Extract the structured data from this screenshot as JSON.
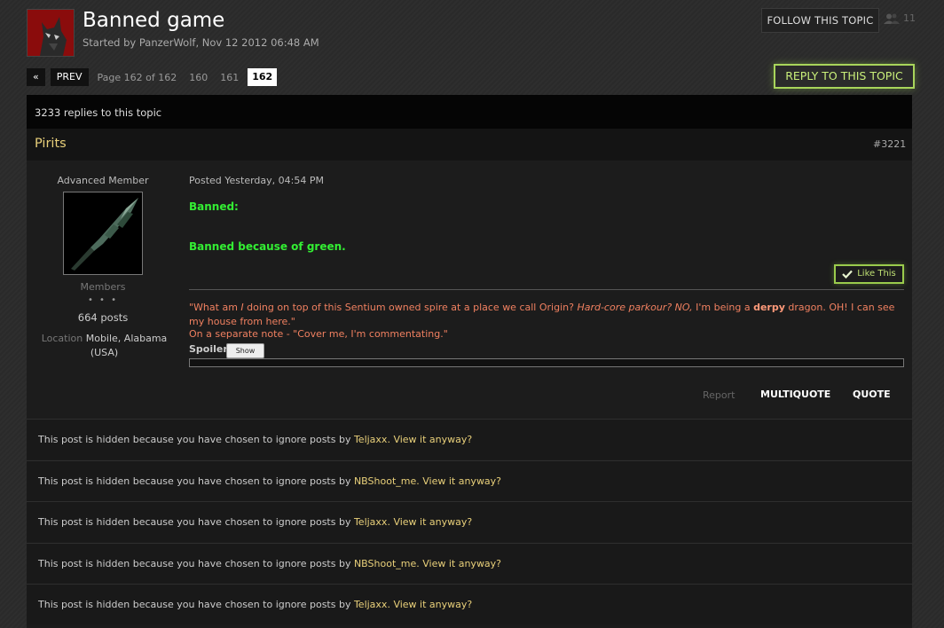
{
  "topic": {
    "title": "Banned game",
    "started": "Started by PanzerWolf, Nov 12 2012 06:48 AM",
    "follow_label": "FOLLOW THIS TOPIC",
    "followers": "11"
  },
  "pagination": {
    "first": "«",
    "prev": "PREV",
    "info": "Page 162 of 162",
    "pages": [
      "160",
      "161"
    ],
    "current": "162"
  },
  "reply_label": "REPLY TO THIS TOPIC",
  "replies_text": "3233 replies to this topic",
  "post": {
    "author": "Pirits",
    "number": "#3221",
    "rank": "Advanced Member",
    "group": "Members",
    "pips": "• • •",
    "post_count": "664 posts",
    "location_label": "Location",
    "location_value": "Mobile, Alabama (USA)",
    "posted": "Posted Yesterday, 04:54 PM",
    "text1": "Banned:",
    "text2": "Banned because of green.",
    "like_label": "Like This",
    "sig_a": "\"What am ",
    "sig_b": "I",
    "sig_c": " doing on top of this Sentium owned spire at a place we call Origin? ",
    "sig_d": "Hard-core parkour? NO,",
    "sig_e": " I'm being a ",
    "sig_f": "derpy",
    "sig_g": " dragon. OH! I can see my house from here.\"",
    "sig_line2": "On a separate note - \"Cover me, I'm commentating.\"",
    "spoiler_label": "Spoiler",
    "spoiler_button": "Show",
    "report": "Report",
    "multiquote": "MULTIQUOTE",
    "quote": "QUOTE"
  },
  "hidden_posts": [
    {
      "prefix": "This post is hidden because you have chosen to ignore posts by ",
      "user": "Teljaxx.",
      "view": "View it anyway?"
    },
    {
      "prefix": "This post is hidden because you have chosen to ignore posts by ",
      "user": "NBShoot_me.",
      "view": "View it anyway?"
    },
    {
      "prefix": "This post is hidden because you have chosen to ignore posts by ",
      "user": "Teljaxx.",
      "view": "View it anyway?"
    },
    {
      "prefix": "This post is hidden because you have chosen to ignore posts by ",
      "user": "NBShoot_me.",
      "view": "View it anyway?"
    },
    {
      "prefix": "This post is hidden because you have chosen to ignore posts by ",
      "user": "Teljaxx.",
      "view": "View it anyway?"
    }
  ]
}
